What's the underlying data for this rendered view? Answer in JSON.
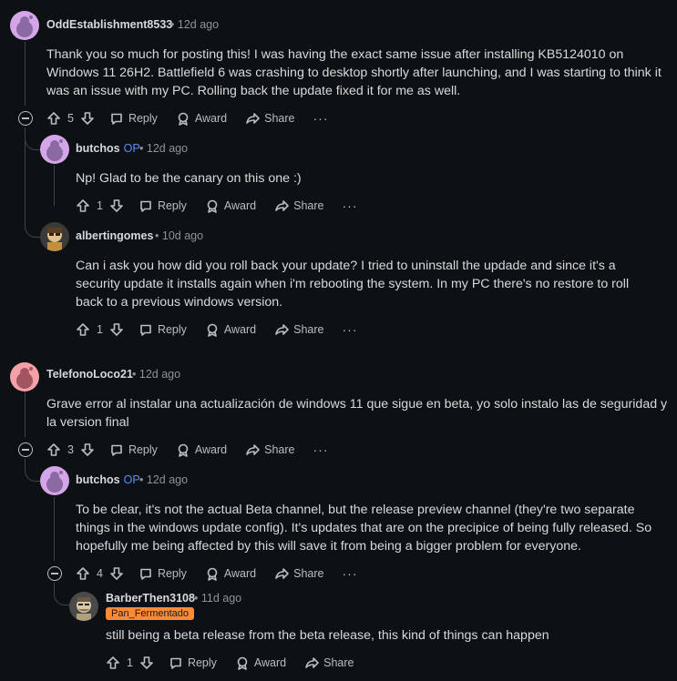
{
  "comments": [
    {
      "username": "OddEstablishment8533",
      "time": "12d ago",
      "body": "Thank you so much for posting this! I was having the exact same issue after installing KB5124010 on Windows 11 26H2. Battlefield 6 was crashing to desktop shortly after launching, and I was starting to think it was an issue with my PC. Rolling back the update fixed it for me as well.",
      "votes": "5"
    },
    {
      "username": "butchos",
      "op": "OP",
      "time": "12d ago",
      "body": "Np! Glad to be the canary on this one :)",
      "votes": "1"
    },
    {
      "username": "albertingomes",
      "time": "10d ago",
      "body": "Can i ask you how did you roll back your update? I tried to uninstall the updade and since it's a security update it installs again when i'm rebooting the system. In my PC there's no restore to roll back to a previous windows version.",
      "votes": "1"
    },
    {
      "username": "TelefonoLoco21",
      "time": "12d ago",
      "body": "Grave error al instalar una actualización de windows 11 que sigue en beta, yo solo instalo las de seguridad y la version final",
      "votes": "3"
    },
    {
      "username": "butchos",
      "op": "OP",
      "time": "12d ago",
      "body": "To be clear, it's not the actual Beta channel, but the release preview channel (they're two separate things in the windows update config). It's updates that are on the precipice of being fully released. So hopefully me being affected by this will save it from being a bigger problem for everyone.",
      "votes": "4"
    },
    {
      "username": "BarberThen3108",
      "time": "11d ago",
      "flair": "Pan_Fermentado",
      "body": "still being a beta release from the beta release, this kind of things can happen",
      "votes": "1"
    }
  ],
  "labels": {
    "reply": "Reply",
    "award": "Award",
    "share": "Share",
    "more": "···",
    "sep": "•"
  },
  "colors": {
    "background": "#0e1113",
    "op": "#5a8cff",
    "flair": "#ff8a36"
  },
  "icons": [
    "upvote-icon",
    "downvote-icon",
    "reply-icon",
    "award-icon",
    "share-icon",
    "collapse-icon",
    "more-icon"
  ]
}
